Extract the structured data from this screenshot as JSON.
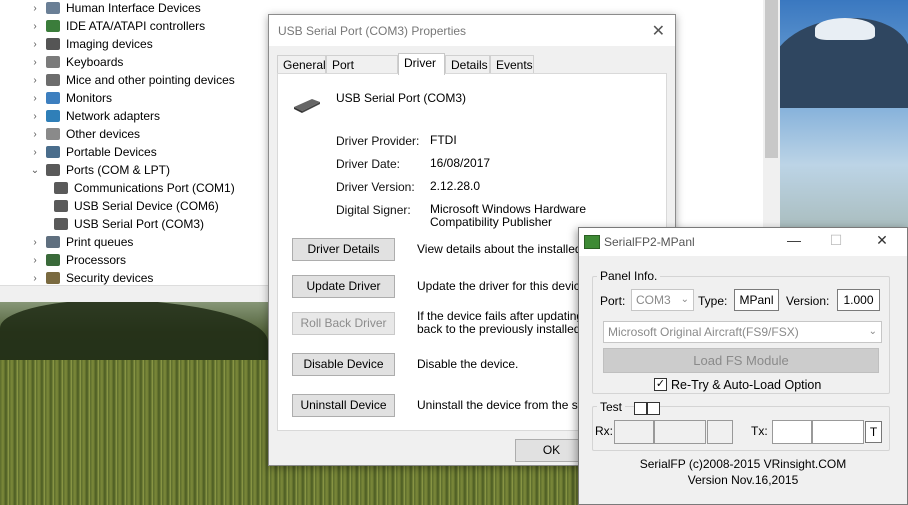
{
  "device_manager": {
    "tree": [
      {
        "label": "Human Interface Devices",
        "expanded": false,
        "icon": "hid-icon",
        "color": "#6a7f96"
      },
      {
        "label": "IDE ATA/ATAPI controllers",
        "expanded": false,
        "icon": "ide-controller-icon",
        "color": "#3b7d3b"
      },
      {
        "label": "Imaging devices",
        "expanded": false,
        "icon": "camera-icon",
        "color": "#555555"
      },
      {
        "label": "Keyboards",
        "expanded": false,
        "icon": "keyboard-icon",
        "color": "#7b7b7b"
      },
      {
        "label": "Mice and other pointing devices",
        "expanded": false,
        "icon": "mouse-icon",
        "color": "#6d6d6d"
      },
      {
        "label": "Monitors",
        "expanded": false,
        "icon": "monitor-icon",
        "color": "#3d7fbf"
      },
      {
        "label": "Network adapters",
        "expanded": false,
        "icon": "network-icon",
        "color": "#2f7fb8"
      },
      {
        "label": "Other devices",
        "expanded": false,
        "icon": "unknown-device-icon",
        "color": "#8a8a8a"
      },
      {
        "label": "Portable Devices",
        "expanded": false,
        "icon": "portable-device-icon",
        "color": "#4a6d8c"
      },
      {
        "label": "Ports (COM & LPT)",
        "expanded": true,
        "icon": "port-icon",
        "color": "#5a5a5a"
      },
      {
        "label": "Communications Port (COM1)",
        "child": true,
        "icon": "port-icon",
        "color": "#5a5a5a"
      },
      {
        "label": "USB Serial Device (COM6)",
        "child": true,
        "icon": "port-icon",
        "color": "#5a5a5a"
      },
      {
        "label": "USB Serial Port (COM3)",
        "child": true,
        "icon": "port-icon",
        "color": "#5a5a5a"
      },
      {
        "label": "Print queues",
        "expanded": false,
        "icon": "printer-icon",
        "color": "#5f6f7f"
      },
      {
        "label": "Processors",
        "expanded": false,
        "icon": "processor-icon",
        "color": "#3a6a3a"
      },
      {
        "label": "Security devices",
        "expanded": false,
        "icon": "security-icon",
        "color": "#7a6a40"
      }
    ]
  },
  "props": {
    "title": "USB Serial Port (COM3) Properties",
    "tabs": [
      "General",
      "Port Settings",
      "Driver",
      "Details",
      "Events"
    ],
    "active_tab": "Driver",
    "device_name": "USB Serial Port (COM3)",
    "info": [
      {
        "label": "Driver Provider:",
        "value": "FTDI"
      },
      {
        "label": "Driver Date:",
        "value": "16/08/2017"
      },
      {
        "label": "Driver Version:",
        "value": "2.12.28.0"
      },
      {
        "label": "Digital Signer:",
        "value": "Microsoft Windows Hardware Compatibility Publisher"
      }
    ],
    "buttons": [
      {
        "label": "Driver Details",
        "desc": "View details about the installed driv",
        "disabled": false
      },
      {
        "label": "Update Driver",
        "desc": "Update the driver for this device.",
        "disabled": false
      },
      {
        "label": "Roll Back Driver",
        "desc": "If the device fails after updating the\nback to the previously installed driv",
        "disabled": true
      },
      {
        "label": "Disable Device",
        "desc": "Disable the device.",
        "disabled": false
      },
      {
        "label": "Uninstall Device",
        "desc": "Uninstall the device from the syster",
        "disabled": false
      }
    ],
    "ok_label": "OK"
  },
  "serialfp": {
    "title": "SerialFP2-MPanl",
    "panel_info_label": "Panel Info.",
    "port_label": "Port:",
    "port_value": "COM3",
    "type_label": "Type:",
    "type_value": "MPanl",
    "version_label": "Version:",
    "version_value": "1.000",
    "sim_value": "Microsoft Original Aircraft(FS9/FSX)",
    "load_button": "Load FS Module",
    "retry_label": "Re-Try & Auto-Load Option",
    "retry_checked": true,
    "test_label": "Test",
    "rx_label": "Rx:",
    "tx_label": "Tx:",
    "t_button": "T",
    "footer_copyright": "SerialFP (c)2008-2015 VRinsight.COM",
    "footer_version": "Version Nov.16,2015",
    "controls": {
      "minimize": "—",
      "maximize": "☐",
      "close": "✕"
    }
  }
}
